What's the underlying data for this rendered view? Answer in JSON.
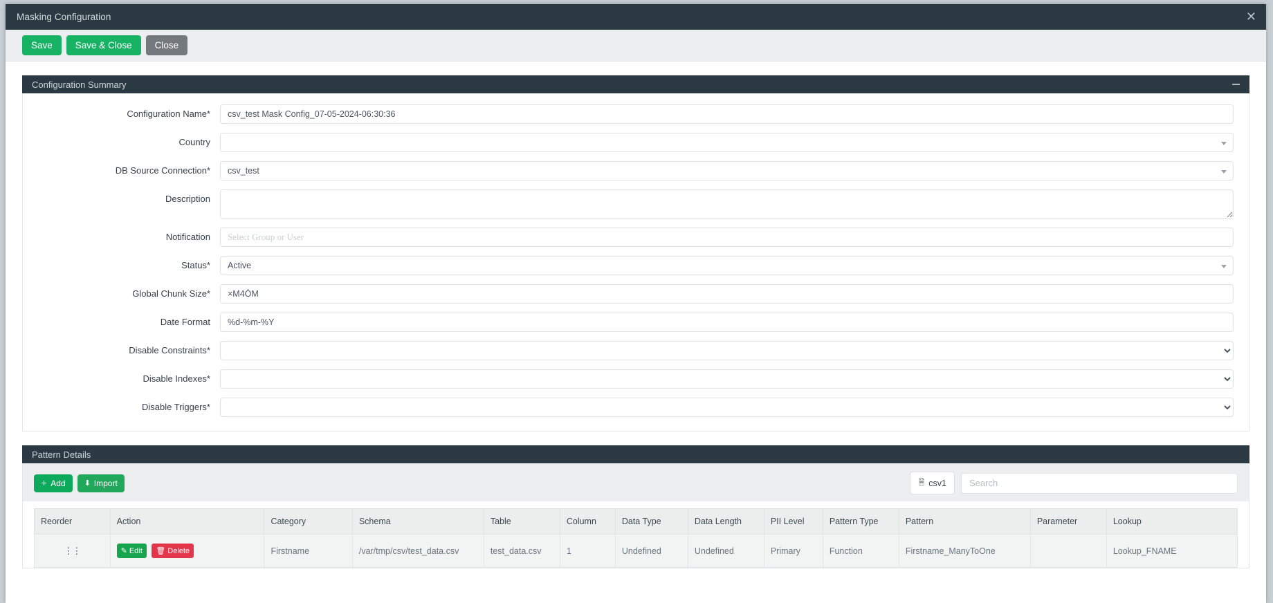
{
  "window": {
    "title": "Masking Configuration",
    "close_icon": "close-icon"
  },
  "toolbar": {
    "save_label": "Save",
    "save_close_label": "Save & Close",
    "close_label": "Close"
  },
  "config_summary": {
    "panel_title": "Configuration Summary",
    "collapse_icon": "minus-icon",
    "fields": {
      "configuration_name": {
        "label": "Configuration Name*",
        "value": "csv_test Mask Config_07-05-2024-06:30:36"
      },
      "country": {
        "label": "Country",
        "value": ""
      },
      "db_source_connection": {
        "label": "DB Source Connection*",
        "value": "csv_test"
      },
      "description": {
        "label": "Description",
        "value": ""
      },
      "notification": {
        "label": "Notification",
        "value": "",
        "placeholder": "Select Group or User"
      },
      "status": {
        "label": "Status*",
        "value": "Active"
      },
      "global_chunk_size": {
        "label": "Global Chunk Size*",
        "value": "×M4ÓM"
      },
      "date_format": {
        "label": "Date Format",
        "value": "%d-%m-%Y"
      },
      "disable_constraints": {
        "label": "Disable Constraints*",
        "value": ""
      },
      "disable_indexes": {
        "label": "Disable Indexes*",
        "value": ""
      },
      "disable_triggers": {
        "label": "Disable Triggers*",
        "value": ""
      }
    }
  },
  "pattern_details": {
    "panel_title": "Pattern Details",
    "add_label": "Add",
    "add_icon": "plus-icon",
    "import_label": "Import",
    "import_icon": "download-icon",
    "file_tab_label": "csv1",
    "file_tab_icon": "file-csv-icon",
    "search_placeholder": "Search",
    "search_value": "",
    "columns": [
      "Reorder",
      "Action",
      "Category",
      "Schema",
      "Table",
      "Column",
      "Data Type",
      "Data Length",
      "PII Level",
      "Pattern Type",
      "Pattern",
      "Parameter",
      "Lookup"
    ],
    "rows": [
      {
        "reorder_icon": "drag-handle-icon",
        "edit_label": "Edit",
        "edit_icon": "pencil-icon",
        "delete_label": "Delete",
        "delete_icon": "trash-icon",
        "category": "Firstname",
        "schema": "/var/tmp/csv/test_data.csv",
        "table": "test_data.csv",
        "column": "1",
        "data_type": "Undefined",
        "data_length": "Undefined",
        "pii_level": "Primary",
        "pattern_type": "Function",
        "pattern": "Firstname_ManyToOne",
        "parameter": "",
        "lookup": "Lookup_FNAME"
      }
    ]
  },
  "colors": {
    "header_bg": "#2b3a42",
    "green": "#18b264",
    "grey": "#74797d",
    "red": "#e3364a"
  }
}
